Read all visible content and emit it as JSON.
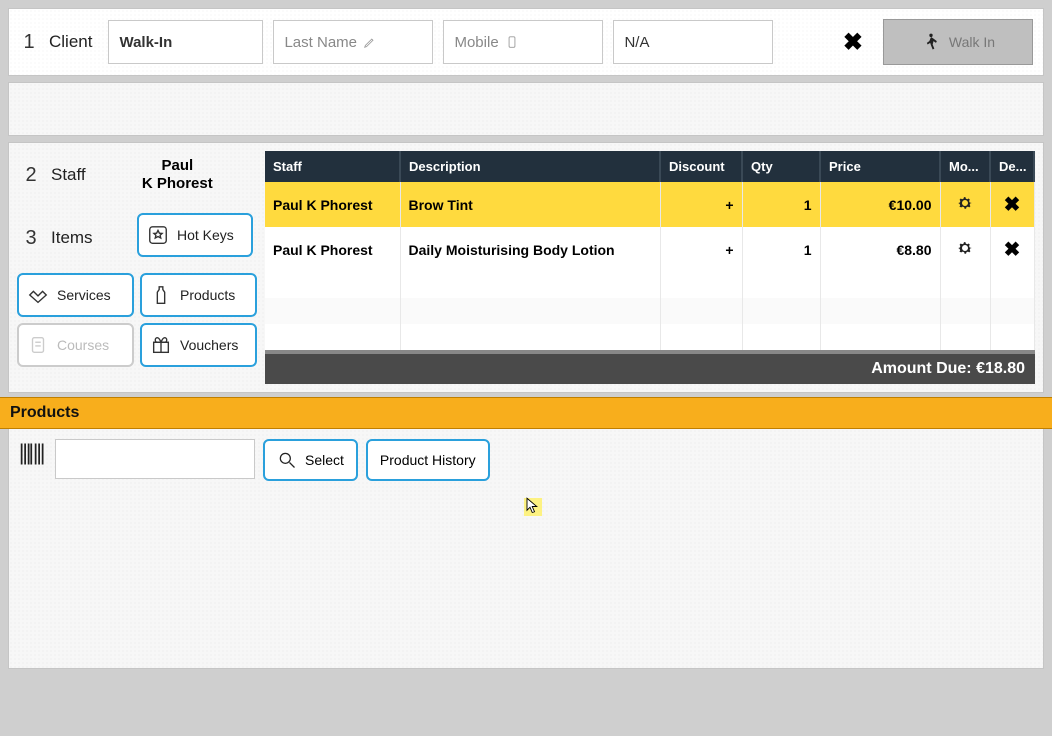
{
  "client": {
    "step": "1",
    "label": "Client",
    "first_value": "Walk-In",
    "last_placeholder": "Last Name",
    "mobile_placeholder": "Mobile",
    "na_value": "N/A",
    "walkin_label": "Walk In"
  },
  "staff": {
    "step": "2",
    "label": "Staff",
    "name_line1": "Paul",
    "name_line2": "K Phorest"
  },
  "items": {
    "step": "3",
    "label": "Items",
    "btn_hotkeys": "Hot Keys",
    "btn_services": "Services",
    "btn_products": "Products",
    "btn_courses": "Courses",
    "btn_vouchers": "Vouchers"
  },
  "table": {
    "hdr_staff": "Staff",
    "hdr_desc": "Description",
    "hdr_disc": "Discount",
    "hdr_qty": "Qty",
    "hdr_price": "Price",
    "hdr_more": "Mo...",
    "hdr_del": "De...",
    "rows": [
      {
        "staff": "Paul K Phorest",
        "desc": "Brow Tint",
        "disc": "+",
        "qty": "1",
        "price": "€10.00"
      },
      {
        "staff": "Paul K Phorest",
        "desc": "Daily Moisturising Body Lotion",
        "disc": "+",
        "qty": "1",
        "price": "€8.80"
      }
    ],
    "amount_due": "Amount Due: €18.80"
  },
  "products": {
    "title": "Products",
    "btn_select": "Select",
    "btn_history": "Product History"
  }
}
